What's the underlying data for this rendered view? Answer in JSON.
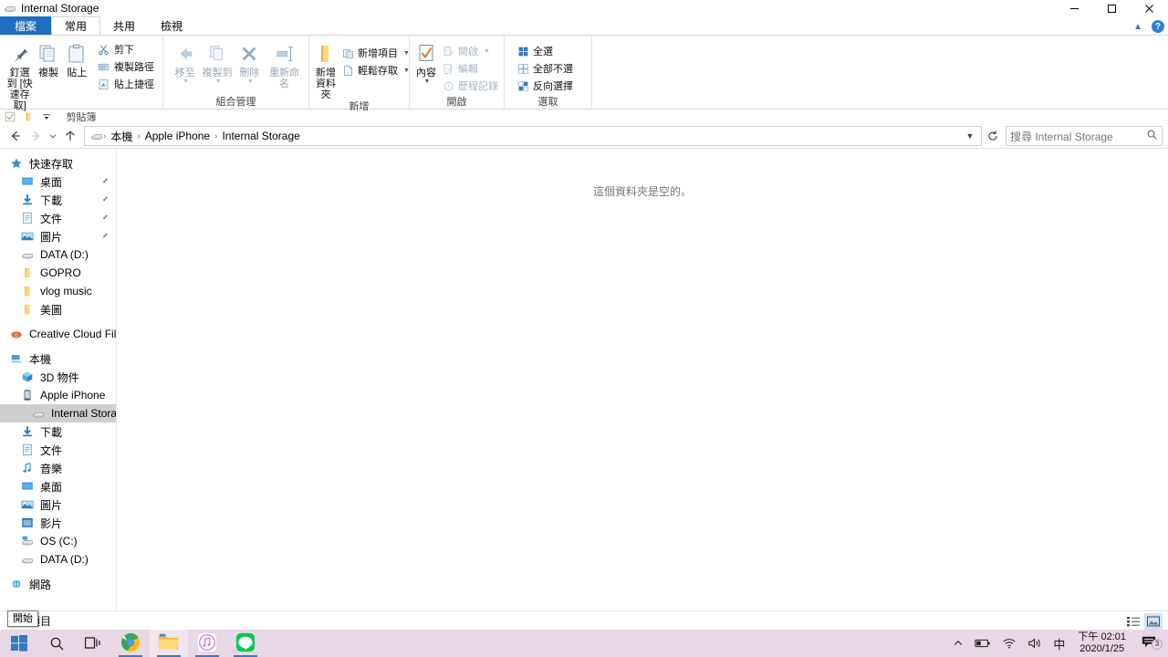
{
  "window": {
    "title": "Internal Storage",
    "minimize_label": "─",
    "maximize_label": "❐",
    "close_label": "✕"
  },
  "ribbon": {
    "tabs": [
      {
        "label": "檔案",
        "state": "file"
      },
      {
        "label": "常用",
        "state": "active"
      },
      {
        "label": "共用",
        "state": "inactive"
      },
      {
        "label": "檢視",
        "state": "inactive"
      }
    ],
    "collapse_icon": "chevron-up-icon",
    "help_label": "?",
    "groups": [
      {
        "title": "剪貼簿",
        "big_buttons": [
          {
            "label": "釘選到 [快速存取]",
            "icon": "pin-icon",
            "dim": false
          },
          {
            "label": "複製",
            "icon": "copy-icon",
            "dim": false
          },
          {
            "label": "貼上",
            "icon": "paste-icon",
            "dim": false
          }
        ],
        "small_buttons": [
          {
            "label": "剪下",
            "icon": "scissors-icon",
            "dim": false
          },
          {
            "label": "複製路徑",
            "icon": "copy-path-icon",
            "dim": false
          },
          {
            "label": "貼上捷徑",
            "icon": "paste-shortcut-icon",
            "dim": false
          }
        ]
      },
      {
        "title": "組合管理",
        "big_buttons": [
          {
            "label": "移至",
            "icon": "move-to-icon",
            "dim": true,
            "caret": true
          },
          {
            "label": "複製到",
            "icon": "copy-to-icon",
            "dim": true,
            "caret": true
          },
          {
            "label": "刪除",
            "icon": "delete-icon",
            "dim": true,
            "caret": true
          },
          {
            "label": "重新命名",
            "icon": "rename-icon",
            "dim": true
          }
        ],
        "small_buttons": []
      },
      {
        "title": "新增",
        "big_buttons": [
          {
            "label": "新增資料夾",
            "icon": "new-folder-icon",
            "dim": false
          }
        ],
        "small_buttons": [
          {
            "label": "新增項目",
            "icon": "new-item-icon",
            "dim": false,
            "caret": true
          },
          {
            "label": "輕鬆存取",
            "icon": "easy-access-icon",
            "dim": false,
            "caret": true
          }
        ]
      },
      {
        "title": "開啟",
        "big_buttons": [
          {
            "label": "內容",
            "icon": "properties-icon",
            "dim": false,
            "caret": true
          }
        ],
        "small_buttons": [
          {
            "label": "開啟",
            "icon": "open-icon",
            "dim": true,
            "caret": true
          },
          {
            "label": "編輯",
            "icon": "edit-icon",
            "dim": true
          },
          {
            "label": "歷程記錄",
            "icon": "history-icon",
            "dim": true
          }
        ]
      },
      {
        "title": "選取",
        "big_buttons": [],
        "small_buttons": [
          {
            "label": "全選",
            "icon": "select-all-icon",
            "dim": false
          },
          {
            "label": "全部不選",
            "icon": "select-none-icon",
            "dim": false
          },
          {
            "label": "反向選擇",
            "icon": "invert-selection-icon",
            "dim": false
          }
        ]
      }
    ]
  },
  "quick_access": {
    "items": [
      {
        "icon": "properties-checkbox-icon"
      },
      {
        "icon": "new-folder-icon"
      },
      {
        "icon": "customize-dropdown-icon"
      }
    ]
  },
  "address_bar": {
    "back_icon": "arrow-left-icon",
    "forward_icon": "arrow-right-icon",
    "recent_icon": "chevron-down-icon",
    "up_icon": "arrow-up-icon",
    "location_icon": "device-icon",
    "breadcrumbs": [
      "本機",
      "Apple iPhone",
      "Internal Storage"
    ],
    "separator": "›",
    "dropdown_icon": "chevron-down-icon",
    "refresh_icon": "refresh-icon"
  },
  "search": {
    "placeholder": "搜尋 Internal Storage",
    "icon": "search-icon"
  },
  "navigation_pane": {
    "items": [
      {
        "label": "快速存取",
        "icon": "star-icon",
        "level": 0,
        "pinned": false,
        "selected": false
      },
      {
        "label": "桌面",
        "icon": "desktop-icon",
        "level": 1,
        "pinned": true,
        "selected": false
      },
      {
        "label": "下載",
        "icon": "downloads-icon",
        "level": 1,
        "pinned": true,
        "selected": false
      },
      {
        "label": "文件",
        "icon": "documents-icon",
        "level": 1,
        "pinned": true,
        "selected": false
      },
      {
        "label": "圖片",
        "icon": "pictures-icon",
        "level": 1,
        "pinned": true,
        "selected": false
      },
      {
        "label": "DATA (D:)",
        "icon": "drive-icon",
        "level": 1,
        "pinned": false,
        "selected": false
      },
      {
        "label": "GOPRO",
        "icon": "folder-icon",
        "level": 1,
        "pinned": false,
        "selected": false
      },
      {
        "label": "vlog music",
        "icon": "folder-icon",
        "level": 1,
        "pinned": false,
        "selected": false
      },
      {
        "label": "美圖",
        "icon": "folder-icon",
        "level": 1,
        "pinned": false,
        "selected": false
      },
      {
        "label": "Creative Cloud Files",
        "icon": "creative-cloud-icon",
        "level": 0,
        "pinned": false,
        "selected": false,
        "gap_before": true
      },
      {
        "label": "本機",
        "icon": "this-pc-icon",
        "level": 0,
        "pinned": false,
        "selected": false,
        "gap_before": true
      },
      {
        "label": "3D 物件",
        "icon": "3d-objects-icon",
        "level": 1,
        "pinned": false,
        "selected": false
      },
      {
        "label": "Apple iPhone",
        "icon": "phone-icon",
        "level": 1,
        "pinned": false,
        "selected": false
      },
      {
        "label": "Internal Storage",
        "icon": "drive-icon",
        "level": 2,
        "pinned": false,
        "selected": true
      },
      {
        "label": "下載",
        "icon": "downloads-icon",
        "level": 1,
        "pinned": false,
        "selected": false
      },
      {
        "label": "文件",
        "icon": "documents-icon",
        "level": 1,
        "pinned": false,
        "selected": false
      },
      {
        "label": "音樂",
        "icon": "music-icon",
        "level": 1,
        "pinned": false,
        "selected": false
      },
      {
        "label": "桌面",
        "icon": "desktop-icon",
        "level": 1,
        "pinned": false,
        "selected": false
      },
      {
        "label": "圖片",
        "icon": "pictures-icon",
        "level": 1,
        "pinned": false,
        "selected": false
      },
      {
        "label": "影片",
        "icon": "videos-icon",
        "level": 1,
        "pinned": false,
        "selected": false
      },
      {
        "label": "OS (C:)",
        "icon": "os-drive-icon",
        "level": 1,
        "pinned": false,
        "selected": false
      },
      {
        "label": "DATA (D:)",
        "icon": "drive-icon",
        "level": 1,
        "pinned": false,
        "selected": false
      },
      {
        "label": "網路",
        "icon": "network-icon",
        "level": 0,
        "pinned": false,
        "selected": false,
        "gap_before": true
      }
    ]
  },
  "content": {
    "empty_message": "這個資料夾是空的。"
  },
  "status_bar": {
    "item_count_text": "0 個項目",
    "details_view_icon": "details-view-icon",
    "large_icons_view_icon": "large-icons-view-icon"
  },
  "tooltip": {
    "text": "開始"
  },
  "taskbar": {
    "start_icon": "windows-start-icon",
    "search_icon": "search-icon",
    "taskview_icon": "task-view-icon",
    "apps": [
      {
        "name": "chrome",
        "icon": "chrome-icon",
        "running": true,
        "active": false
      },
      {
        "name": "file-explorer",
        "icon": "file-explorer-icon",
        "running": true,
        "active": true
      },
      {
        "name": "itunes",
        "icon": "itunes-icon",
        "running": true,
        "active": false
      },
      {
        "name": "line",
        "icon": "line-icon",
        "running": true,
        "active": false
      }
    ],
    "tray": {
      "overflow_icon": "chevron-up-icon",
      "battery_icon": "battery-icon",
      "wifi_icon": "wifi-icon",
      "volume_icon": "volume-icon",
      "ime_label": "中",
      "time": "下午 02:01",
      "date": "2020/1/25",
      "notification_icon": "notifications-icon",
      "notification_count": "3"
    }
  },
  "colors": {
    "file_tab_blue": "#1e6fbf",
    "accent_blue": "#3b78c3",
    "selection_gray": "#cfcfcf",
    "taskbar_bg": "#e8d7e4"
  }
}
